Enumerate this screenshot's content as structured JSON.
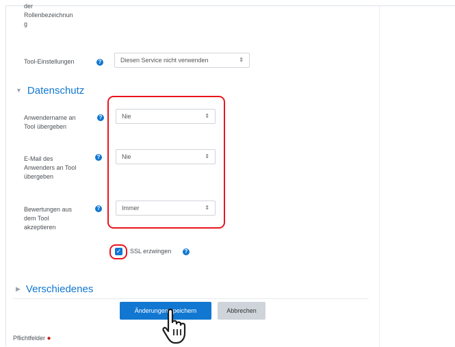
{
  "top_label": {
    "line1": "der",
    "line2": "Rollenbezeichnun",
    "line3": "g"
  },
  "tool_settings": {
    "label": "Tool-Einstellungen",
    "value": "Diesen Service nicht verwenden"
  },
  "privacy": {
    "title": "Datenschutz",
    "share_name": {
      "label_line1": "Anwendername an",
      "label_line2": "Tool übergeben",
      "value": "Nie"
    },
    "share_email": {
      "label_line1": "E-Mail des",
      "label_line2": "Anwenders an Tool",
      "label_line3": "übergeben",
      "value": "Nie"
    },
    "accept_grades": {
      "label_line1": "Bewertungen aus",
      "label_line2": "dem Tool",
      "label_line3": "akzeptieren",
      "value": "Immer"
    },
    "force_ssl": {
      "label": "SSL erzwingen",
      "checked": true
    }
  },
  "misc": {
    "title": "Verschiedenes"
  },
  "actions": {
    "save_label": "Änderungen speichern",
    "cancel_label": "Abbrechen"
  },
  "footer": {
    "required_label": "Pflichtfelder"
  },
  "colors": {
    "accent": "#1177d1",
    "highlight": "#e8141c"
  }
}
